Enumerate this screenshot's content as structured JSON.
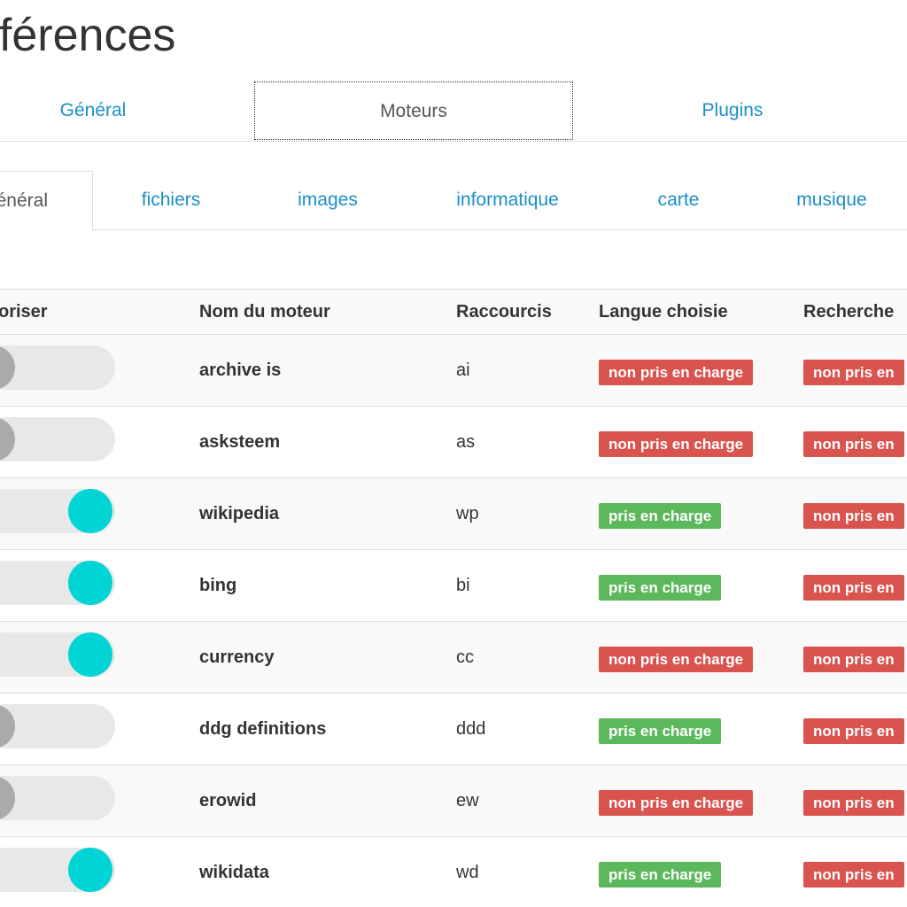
{
  "page": {
    "title": "éférences"
  },
  "main_tabs": [
    {
      "label": "Général",
      "active": false
    },
    {
      "label": "Moteurs",
      "active": true
    },
    {
      "label": "Plugins",
      "active": false
    }
  ],
  "sub_tabs": [
    {
      "label": "énéral",
      "active": true
    },
    {
      "label": "fichiers",
      "active": false
    },
    {
      "label": "images",
      "active": false
    },
    {
      "label": "informatique",
      "active": false
    },
    {
      "label": "carte",
      "active": false
    },
    {
      "label": "musique",
      "active": false
    }
  ],
  "table": {
    "headers": [
      "oriser",
      "Nom du moteur",
      "Raccourcis",
      "Langue choisie",
      "Recherche"
    ],
    "rows": [
      {
        "enabled": false,
        "name": "archive is",
        "shortcut": "ai",
        "language": "non pris en charge",
        "language_supported": false,
        "search": "non pris en"
      },
      {
        "enabled": false,
        "name": "asksteem",
        "shortcut": "as",
        "language": "non pris en charge",
        "language_supported": false,
        "search": "non pris en"
      },
      {
        "enabled": true,
        "name": "wikipedia",
        "shortcut": "wp",
        "language": "pris en charge",
        "language_supported": true,
        "search": "non pris en"
      },
      {
        "enabled": true,
        "name": "bing",
        "shortcut": "bi",
        "language": "pris en charge",
        "language_supported": true,
        "search": "non pris en"
      },
      {
        "enabled": true,
        "name": "currency",
        "shortcut": "cc",
        "language": "non pris en charge",
        "language_supported": false,
        "search": "non pris en"
      },
      {
        "enabled": false,
        "name": "ddg definitions",
        "shortcut": "ddd",
        "language": "pris en charge",
        "language_supported": true,
        "search": "non pris en"
      },
      {
        "enabled": false,
        "name": "erowid",
        "shortcut": "ew",
        "language": "non pris en charge",
        "language_supported": false,
        "search": "non pris en"
      },
      {
        "enabled": true,
        "name": "wikidata",
        "shortcut": "wd",
        "language": "pris en charge",
        "language_supported": true,
        "search": "non pris en"
      }
    ]
  },
  "colors": {
    "link": "#1a8fc9",
    "toggle_on": "#00d4d4",
    "toggle_off": "#aaaaaa",
    "label_unsupported": "#d9534f",
    "label_supported": "#5cb85c"
  }
}
